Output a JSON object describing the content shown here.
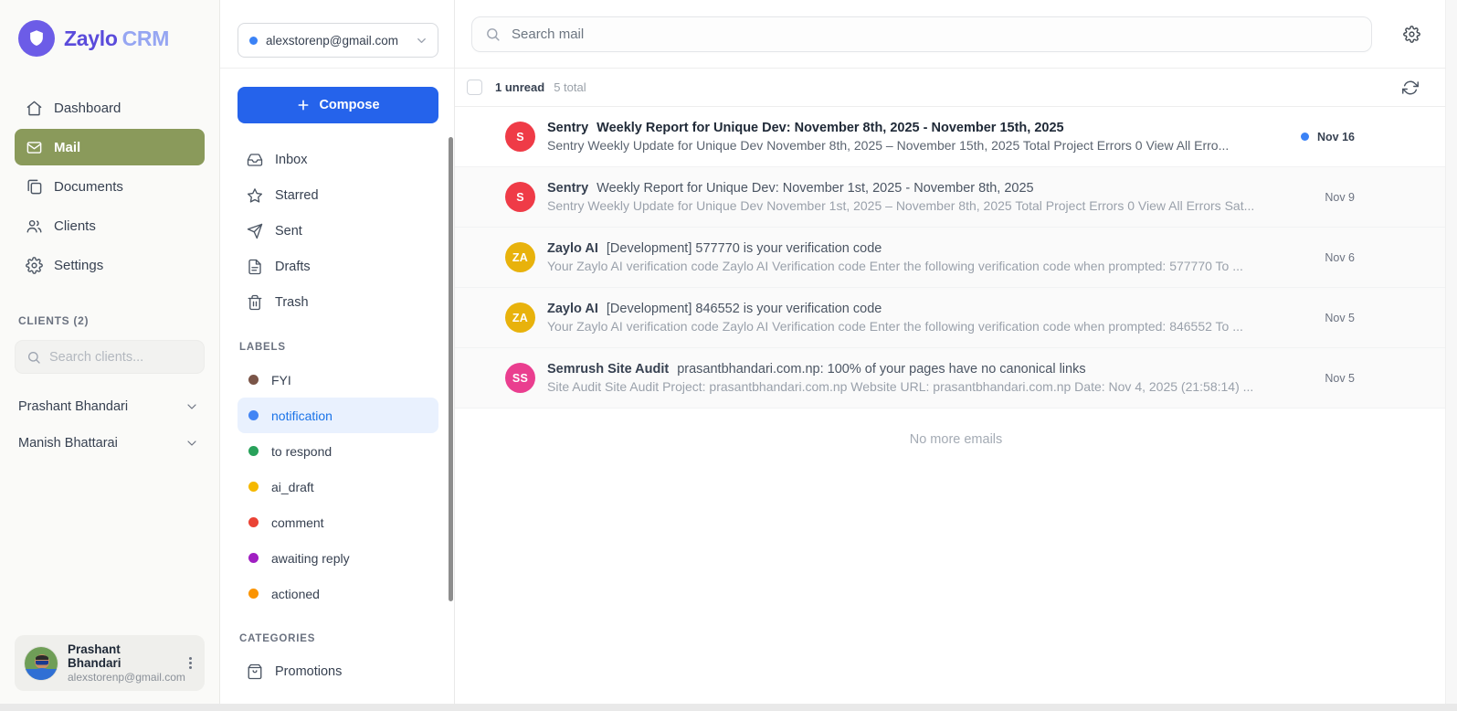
{
  "brand": {
    "name_primary": "Zaylo",
    "name_secondary": "CRM"
  },
  "colors": {
    "brand_purple": "#6c5ce7",
    "active_nav_olive": "#8a9a5b",
    "compose_blue": "#2563eb",
    "unread_dot_blue": "#3b82f6",
    "active_label_blue": "#1a73e8"
  },
  "sidebar": {
    "nav": [
      {
        "label": "Dashboard",
        "icon": "home",
        "active": false
      },
      {
        "label": "Mail",
        "icon": "mail",
        "active": true
      },
      {
        "label": "Documents",
        "icon": "documents",
        "active": false
      },
      {
        "label": "Clients",
        "icon": "clients",
        "active": false
      },
      {
        "label": "Settings",
        "icon": "settings",
        "active": false
      }
    ],
    "clients_header": "CLIENTS (2)",
    "clients_search_placeholder": "Search clients...",
    "clients": [
      {
        "name": "Prashant Bhandari"
      },
      {
        "name": "Manish Bhattarai"
      }
    ],
    "profile": {
      "name": "Prashant Bhandari",
      "email": "alexstorenp@gmail.com"
    }
  },
  "mailcol": {
    "account_email": "alexstorenp@gmail.com",
    "compose_label": "Compose",
    "folders": [
      {
        "label": "Inbox",
        "icon": "inbox"
      },
      {
        "label": "Starred",
        "icon": "star"
      },
      {
        "label": "Sent",
        "icon": "send"
      },
      {
        "label": "Drafts",
        "icon": "draft"
      },
      {
        "label": "Trash",
        "icon": "trash"
      }
    ],
    "labels_header": "LABELS",
    "labels": [
      {
        "name": "FYI",
        "color": "#7a5548",
        "active": false
      },
      {
        "name": "notification",
        "color": "#4285f4",
        "active": true
      },
      {
        "name": "to respond",
        "color": "#28a15a",
        "active": false
      },
      {
        "name": "ai_draft",
        "color": "#f5b800",
        "active": false
      },
      {
        "name": "comment",
        "color": "#ea4335",
        "active": false
      },
      {
        "name": "awaiting reply",
        "color": "#a01fc2",
        "active": false
      },
      {
        "name": "actioned",
        "color": "#fb9402",
        "active": false
      }
    ],
    "categories_header": "CATEGORIES",
    "categories": [
      {
        "label": "Promotions",
        "icon": "promotions"
      }
    ]
  },
  "main": {
    "search_placeholder": "Search mail",
    "unread_text": "1 unread",
    "total_text": "5 total",
    "end_message": "No more emails",
    "emails": [
      {
        "sender": "Sentry",
        "subject": "Weekly Report for Unique Dev: November 8th, 2025 - November 15th, 2025",
        "snippet": "Sentry Weekly Update for Unique Dev November 8th, 2025 – November 15th, 2025 Total Project Errors 0 View All Erro...",
        "date": "Nov 16",
        "unread": true,
        "avatar_text": "S",
        "avatar_color": "#ef3b47"
      },
      {
        "sender": "Sentry",
        "subject": "Weekly Report for Unique Dev: November 1st, 2025 - November 8th, 2025",
        "snippet": "Sentry Weekly Update for Unique Dev November 1st, 2025 – November 8th, 2025 Total Project Errors 0 View All Errors Sat...",
        "date": "Nov 9",
        "unread": false,
        "avatar_text": "S",
        "avatar_color": "#ef3b47"
      },
      {
        "sender": "Zaylo AI",
        "subject": "[Development] 577770 is your verification code",
        "snippet": "Your Zaylo AI verification code Zaylo AI Verification code Enter the following verification code when prompted: 577770 To ...",
        "date": "Nov 6",
        "unread": false,
        "avatar_text": "ZA",
        "avatar_color": "#e8b20c"
      },
      {
        "sender": "Zaylo AI",
        "subject": "[Development] 846552 is your verification code",
        "snippet": "Your Zaylo AI verification code Zaylo AI Verification code Enter the following verification code when prompted: 846552 To ...",
        "date": "Nov 5",
        "unread": false,
        "avatar_text": "ZA",
        "avatar_color": "#e8b20c"
      },
      {
        "sender": "Semrush Site Audit",
        "subject": "prasantbhandari.com.np: 100% of your pages have no canonical links",
        "snippet": "Site Audit Site Audit Project: prasantbhandari.com.np Website URL: prasantbhandari.com.np Date: Nov 4, 2025 (21:58:14) ...",
        "date": "Nov 5",
        "unread": false,
        "avatar_text": "SS",
        "avatar_color": "#ea3e8f"
      }
    ]
  }
}
